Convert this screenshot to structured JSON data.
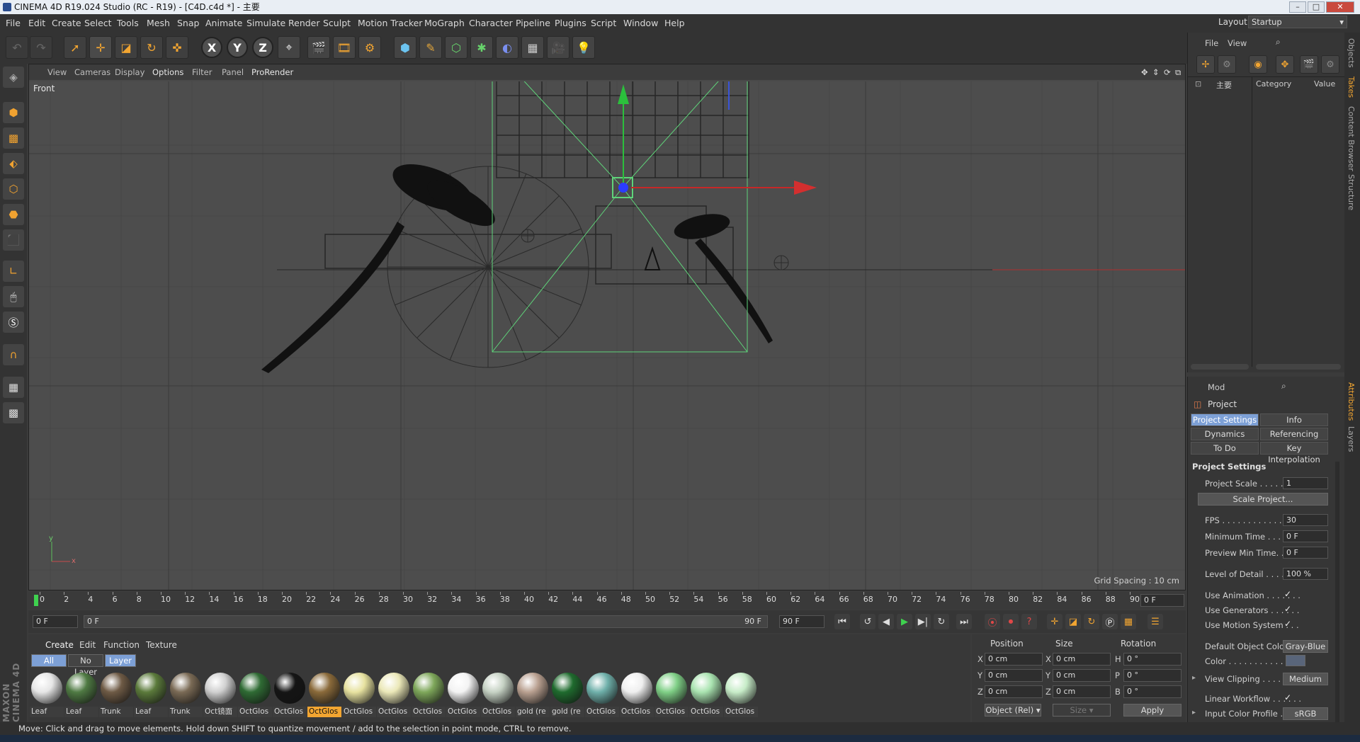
{
  "titlebar": {
    "title": "CINEMA 4D R19.024 Studio (RC - R19) - [C4D.c4d *] - 主要"
  },
  "menubar": {
    "items": [
      "File",
      "Edit",
      "Create",
      "Select",
      "Tools",
      "Mesh",
      "Snap",
      "Animate",
      "Simulate",
      "Render",
      "Sculpt",
      "Motion Tracker",
      "MoGraph",
      "Character",
      "Pipeline",
      "Plugins",
      "Script",
      "Window",
      "Help"
    ],
    "layout_label": "Layout:",
    "layout_value": "Startup"
  },
  "toolbar": {
    "axis_x": "X",
    "axis_y": "Y",
    "axis_z": "Z"
  },
  "viewport": {
    "menu": [
      "View",
      "Cameras",
      "Display",
      "Options",
      "Filter",
      "Panel",
      "ProRender"
    ],
    "view_name": "Front",
    "grid_spacing": "Grid Spacing : 10 cm",
    "axis_y": "y",
    "axis_x": "x"
  },
  "timeline": {
    "ticks": [
      "0",
      "2",
      "4",
      "6",
      "8",
      "10",
      "12",
      "14",
      "16",
      "18",
      "20",
      "22",
      "24",
      "26",
      "28",
      "30",
      "32",
      "34",
      "36",
      "38",
      "40",
      "42",
      "44",
      "46",
      "48",
      "50",
      "52",
      "54",
      "56",
      "58",
      "60",
      "62",
      "64",
      "66",
      "68",
      "70",
      "72",
      "74",
      "76",
      "78",
      "80",
      "82",
      "84",
      "86",
      "88",
      "90"
    ],
    "current_frame": "0 F"
  },
  "playbar": {
    "start": "0 F",
    "range_start": "0 F",
    "range_end": "90 F",
    "end": "90 F"
  },
  "materials": {
    "menu": [
      "Create",
      "Edit",
      "Function",
      "Texture"
    ],
    "tabs": [
      "All",
      "No Layer",
      "Layer"
    ],
    "items": [
      {
        "label": "Leaf",
        "color": "#e6e6e6"
      },
      {
        "label": "Leaf",
        "color": "#4f7a43"
      },
      {
        "label": "Trunk",
        "color": "#6e5a45"
      },
      {
        "label": "Leaf",
        "color": "#5b7a3b"
      },
      {
        "label": "Trunk",
        "color": "#7a6a55"
      },
      {
        "label": "Oct镜面",
        "color": "#d0d0d0"
      },
      {
        "label": "OctGlos",
        "color": "#2f6b34"
      },
      {
        "label": "OctGlos",
        "color": "#151515"
      },
      {
        "label": "OctGlos",
        "color": "#8a6a3a"
      },
      {
        "label": "OctGlos",
        "color": "#e7e2a0"
      },
      {
        "label": "OctGlos",
        "color": "#ebe8b8"
      },
      {
        "label": "OctGlos",
        "color": "#7ea75a"
      },
      {
        "label": "OctGlos",
        "color": "#f3f3f3"
      },
      {
        "label": "OctGlos",
        "color": "#c6d2c4"
      },
      {
        "label": "gold (re",
        "color": "#b9a090"
      },
      {
        "label": "gold (re",
        "color": "#1f6b2e"
      },
      {
        "label": "OctGlos",
        "color": "#6fb0aa"
      },
      {
        "label": "OctGlos",
        "color": "#efefef"
      },
      {
        "label": "OctGlos",
        "color": "#7fcf86"
      },
      {
        "label": "OctGlos",
        "color": "#a9e3b0"
      },
      {
        "label": "OctGlos",
        "color": "#c7ecc8"
      }
    ],
    "selected_index": 8
  },
  "coords": {
    "headers": [
      "Position",
      "Size",
      "Rotation"
    ],
    "rows": [
      {
        "axis": "X",
        "pos": "0 cm",
        "saxis": "X",
        "size": "0 cm",
        "raxis": "H",
        "rot": "0 °"
      },
      {
        "axis": "Y",
        "pos": "0 cm",
        "saxis": "Y",
        "size": "0 cm",
        "raxis": "P",
        "rot": "0 °"
      },
      {
        "axis": "Z",
        "pos": "0 cm",
        "saxis": "Z",
        "size": "0 cm",
        "raxis": "B",
        "rot": "0 °"
      }
    ],
    "mode": "Object (Rel)",
    "size_mode": "Size",
    "apply": "Apply"
  },
  "objects": {
    "menu": [
      "File",
      "View"
    ],
    "root": "主要",
    "col_category": "Category",
    "col_value": "Value"
  },
  "attributes": {
    "menu": "Mod",
    "title": "Project",
    "tabs": [
      "Project Settings",
      "Info",
      "Dynamics",
      "Referencing",
      "To Do",
      "Key Interpolation"
    ],
    "section": "Project Settings",
    "project_scale_label": "Project Scale . . . . . . . .",
    "project_scale": "1",
    "scale_project_btn": "Scale Project...",
    "fps_label": "FPS . . . . . . . . . . . . . . . .",
    "fps": "30",
    "min_time_label": "Minimum Time . . . . . . .",
    "min_time": "0 F",
    "preview_min_label": "Preview Min Time. . . . .",
    "preview_min": "0 F",
    "lod_label": "Level of Detail . . . . . . .",
    "lod": "100 %",
    "use_anim_label": "Use Animation . . . . . . .",
    "use_gen_label": "Use Generators . . . . . .",
    "use_motion_label": "Use Motion System . . .",
    "check": "✓",
    "def_color_label": "Default Object Color",
    "def_color": "Gray-Blue",
    "color_label": "Color . . . . . . . . . . .",
    "view_clip_label": "View Clipping . . . . . . .",
    "view_clip": "Medium",
    "linear_label": "Linear Workflow . . . . . .",
    "input_color_label": "Input Color Profile . . .",
    "input_color": "sRGB"
  },
  "right_tabs": [
    "Objects",
    "Takes",
    "Content Browser",
    "Structure",
    "Attributes",
    "Layers"
  ],
  "status": "Move: Click and drag to move elements. Hold down SHIFT to quantize movement / add to the selection in point mode, CTRL to remove.",
  "branding": "MAXON CINEMA 4D"
}
